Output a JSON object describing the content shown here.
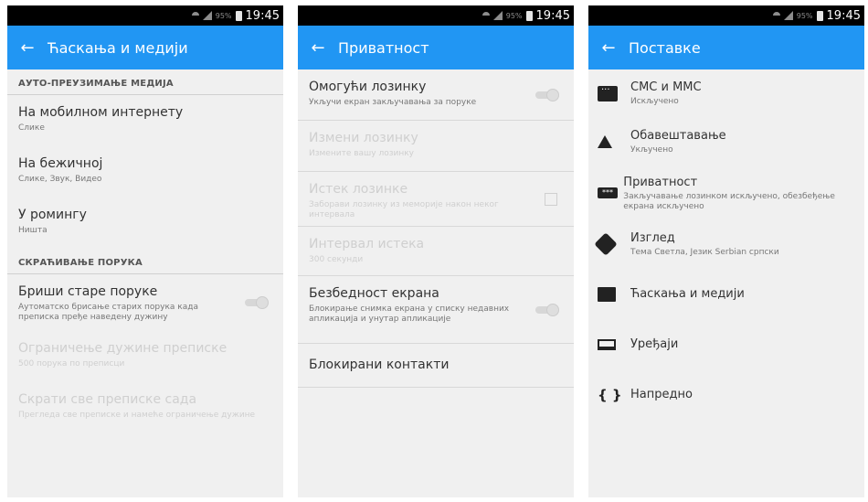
{
  "statusbar": {
    "time": "19:45",
    "battery": "95%"
  },
  "screens": [
    {
      "title": "Ћаскања и медији",
      "section1": "АУТО-ПРЕУЗИМАЊЕ МЕДИЈА",
      "items1": [
        {
          "title": "На мобилном интернету",
          "sub": "Слике"
        },
        {
          "title": "На бежичној",
          "sub": "Слике, Звук, Видео"
        },
        {
          "title": "У ромингу",
          "sub": "Ништа"
        }
      ],
      "section2": "СКРАЋИВАЊЕ ПОРУКА",
      "delete_old": {
        "title": "Бриши старе поруке",
        "sub": "Аутоматско брисање старих порука када преписка пређе наведену дужину"
      },
      "limit": {
        "title": "Ограничење дужине преписке",
        "sub": "500 порука по преписци"
      },
      "trim_now": {
        "title": "Скрати све преписке сада",
        "sub": "Прегледа све преписке и намеће ограничење дужине"
      }
    },
    {
      "title": "Приватност",
      "enable_pass": {
        "title": "Омогући лозинку",
        "sub": "Укључи екран закључавања за поруке"
      },
      "change_pass": {
        "title": "Измени лозинку",
        "sub": "Измените вашу лозинку"
      },
      "pass_timeout": {
        "title": "Истек лозинке",
        "sub": "Заборави лозинку из меморије након неког интервала"
      },
      "timeout_interval": {
        "title": "Интервал истека",
        "sub": "300 секунди"
      },
      "screen_security": {
        "title": "Безбедност екрана",
        "sub": "Блокирање снимка екрана у списку недавних апликација и унутар апликације"
      },
      "blocked": {
        "title": "Блокирани контакти"
      }
    },
    {
      "title": "Поставке",
      "items": [
        {
          "icon": "sms-icon",
          "title": "СМС и ММС",
          "sub": "Искључено"
        },
        {
          "icon": "bell-icon",
          "title": "Обавештавање",
          "sub": "Укључено"
        },
        {
          "icon": "lock-icon",
          "title": "Приватност",
          "sub": "Закључавање лозинком искључено, обезбеђење екрана искључено"
        },
        {
          "icon": "theme-icon",
          "title": "Изглед",
          "sub": "Тема Светла, Језик Serbian српски"
        },
        {
          "icon": "chat-icon",
          "title": "Ћаскања и медији",
          "sub": ""
        },
        {
          "icon": "laptop-icon",
          "title": "Уређаји",
          "sub": ""
        },
        {
          "icon": "braces-icon",
          "title": "Напредно",
          "sub": ""
        }
      ],
      "key_glyph": "***",
      "braces_glyph": "{ }"
    }
  ],
  "colors": {
    "appbar": "#2196f3",
    "statusbar": "#000000",
    "background": "#f0f0f0"
  },
  "icons": {
    "back": "←"
  }
}
